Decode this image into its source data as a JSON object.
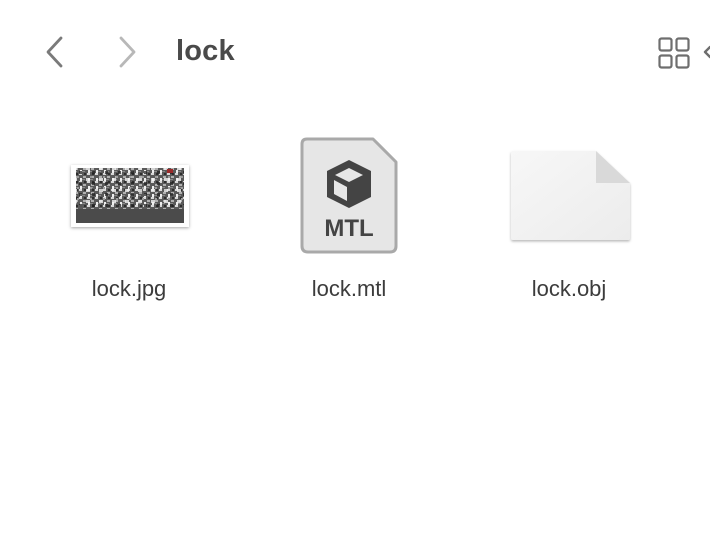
{
  "window": {
    "title": "lock"
  },
  "toolbar": {
    "back_icon": "chevron-left-icon",
    "forward_icon": "chevron-right-icon",
    "view_icon": "grid-view-icon"
  },
  "files": [
    {
      "name": "lock.jpg",
      "kind": "image-thumbnail"
    },
    {
      "name": "lock.mtl",
      "kind": "mtl-document-icon",
      "badge": "MTL"
    },
    {
      "name": "lock.obj",
      "kind": "generic-document-icon"
    }
  ],
  "colors": {
    "background": "#ffffff",
    "title_text": "#4a4a4a",
    "icon_gray": "#7a7a7a",
    "icon_disabled": "#b8b8b8",
    "mtl_border": "#a9a9a9",
    "mtl_fill": "#e6e6e6",
    "mtl_glyph": "#444444"
  }
}
